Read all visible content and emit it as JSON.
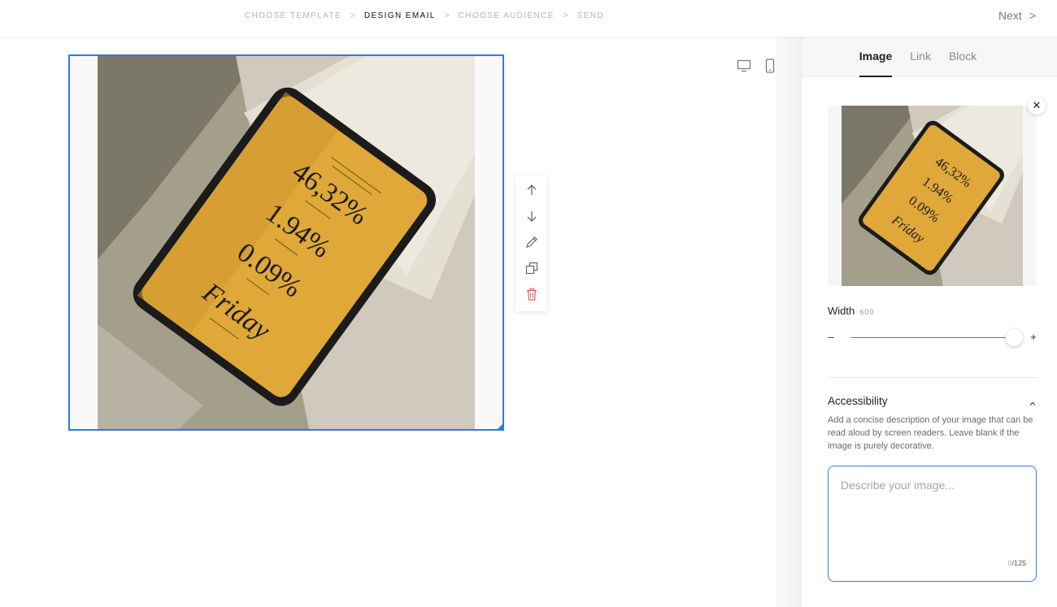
{
  "steps": [
    {
      "label": "CHOOSE TEMPLATE",
      "active": false
    },
    {
      "label": "DESIGN EMAIL",
      "active": true
    },
    {
      "label": "CHOOSE AUDIENCE",
      "active": false
    },
    {
      "label": "SEND",
      "active": false
    }
  ],
  "step_separator": ">",
  "next": {
    "label": "Next",
    "icon": "chevron-right-icon",
    "glyph": ">"
  },
  "canvas": {
    "device_toggle": [
      "desktop-icon",
      "mobile-icon"
    ],
    "tools": [
      "arrow-up-icon",
      "arrow-down-icon",
      "pencil-icon",
      "duplicate-icon",
      "trash-icon"
    ],
    "image_content": {
      "lines": [
        "46,32%",
        "1.94%",
        "0.09%",
        "Friday"
      ]
    }
  },
  "panel": {
    "tabs": [
      {
        "label": "Image",
        "active": true
      },
      {
        "label": "Link",
        "active": false
      },
      {
        "label": "Block",
        "active": false
      }
    ],
    "remove_glyph": "✕",
    "width": {
      "label": "Width",
      "value": "600",
      "minus": "–",
      "plus": "+",
      "level": 1.0
    },
    "accessibility": {
      "title": "Accessibility",
      "description": "Add a concise description of your image that can be read aloud by screen readers. Leave blank if the image is purely decorative.",
      "placeholder": "Describe your image...",
      "count_used": "0",
      "count_max": "/125"
    }
  },
  "colors": {
    "accent": "#2f7ae5",
    "tablet_screen": "#dfa838",
    "background_photo": "#a49f8b",
    "trash": "#e05a5a"
  }
}
